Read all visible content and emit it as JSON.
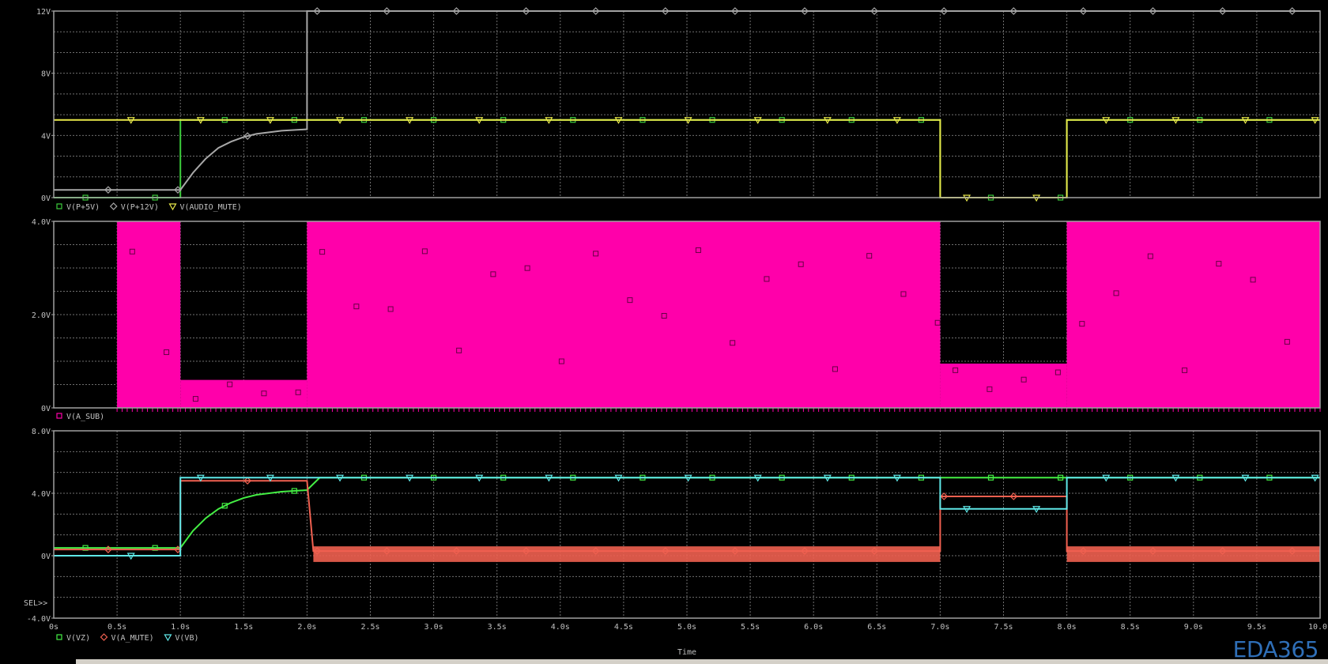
{
  "window": {
    "watermark": "EDA365",
    "sel_marker": "SEL>>"
  },
  "colors": {
    "background": "#000000",
    "grid": "#6f6f6f",
    "frame": "#a0a0a0",
    "text": "#c0c0c0",
    "green": "#3ccc3c",
    "bright_green": "#44ee44",
    "gray": "#a8a8a8",
    "yellow": "#e8e84a",
    "magenta": "#ff00aa",
    "salmon": "#f06050",
    "cyan": "#5fe8e8"
  },
  "chart_data": [
    {
      "type": "line",
      "xlim": [
        0,
        10
      ],
      "ylim": [
        0,
        12
      ],
      "yticks": [
        "0V",
        "4V",
        "8V",
        "12V"
      ],
      "grid": true,
      "legend_placement": "bottom-left",
      "series": [
        {
          "name": "V(P+5V)",
          "color": "green",
          "marker": "square",
          "points": [
            [
              0,
              0
            ],
            [
              1.0,
              0
            ],
            [
              1.0,
              5
            ],
            [
              7.0,
              5
            ],
            [
              7.0,
              0
            ],
            [
              8.0,
              0
            ],
            [
              8.0,
              5
            ],
            [
              10,
              5
            ]
          ]
        },
        {
          "name": "V(P+12V)",
          "color": "gray",
          "marker": "diamond",
          "points": [
            [
              0,
              0.5
            ],
            [
              1.0,
              0.5
            ],
            [
              1.1,
              1.6
            ],
            [
              1.2,
              2.5
            ],
            [
              1.3,
              3.2
            ],
            [
              1.4,
              3.6
            ],
            [
              1.5,
              3.9
            ],
            [
              1.6,
              4.1
            ],
            [
              1.8,
              4.3
            ],
            [
              2.0,
              4.4
            ],
            [
              2.0,
              12
            ],
            [
              10,
              12
            ]
          ]
        },
        {
          "name": "V(AUDIO_MUTE)",
          "color": "yellow",
          "marker": "triangle",
          "points": [
            [
              0,
              5
            ],
            [
              7.0,
              5
            ],
            [
              7.0,
              0
            ],
            [
              8.0,
              0
            ],
            [
              8.0,
              5
            ],
            [
              10,
              5
            ]
          ]
        }
      ]
    },
    {
      "type": "area",
      "xlim": [
        0,
        10
      ],
      "ylim": [
        0,
        4
      ],
      "yticks": [
        "0V",
        "2.0V",
        "4.0V"
      ],
      "grid": true,
      "legend_placement": "bottom-left",
      "series": [
        {
          "name": "V(A_SUB)",
          "color": "magenta",
          "marker": "square",
          "bands": [
            {
              "x": [
                0.5,
                1.0
              ],
              "low": 0,
              "high": 4.0
            },
            {
              "x": [
                1.0,
                2.0
              ],
              "low": 0,
              "high": 0.6
            },
            {
              "x": [
                2.0,
                7.0
              ],
              "low": 0,
              "high": 4.0
            },
            {
              "x": [
                7.0,
                8.0
              ],
              "low": 0,
              "high": 0.95
            },
            {
              "x": [
                8.0,
                10.0
              ],
              "low": 0,
              "high": 4.0
            }
          ]
        }
      ]
    },
    {
      "type": "line",
      "xlim": [
        0,
        10
      ],
      "ylim": [
        -4,
        8
      ],
      "yticks": [
        "-4.0V",
        "0V",
        "4.0V",
        "8.0V"
      ],
      "xticks": [
        "0s",
        "0.5s",
        "1.0s",
        "1.5s",
        "2.0s",
        "2.5s",
        "3.0s",
        "3.5s",
        "4.0s",
        "4.5s",
        "5.0s",
        "5.5s",
        "6.0s",
        "6.5s",
        "7.0s",
        "7.5s",
        "8.0s",
        "8.5s",
        "9.0s",
        "9.5s",
        "10.0s"
      ],
      "xlabel": "Time",
      "grid": true,
      "legend_placement": "bottom-left",
      "series": [
        {
          "name": "V(VZ)",
          "color": "bright_green",
          "marker": "square",
          "points": [
            [
              0,
              0.5
            ],
            [
              1.0,
              0.5
            ],
            [
              1.1,
              1.6
            ],
            [
              1.2,
              2.4
            ],
            [
              1.3,
              3.0
            ],
            [
              1.4,
              3.4
            ],
            [
              1.5,
              3.7
            ],
            [
              1.6,
              3.9
            ],
            [
              1.8,
              4.1
            ],
            [
              2.0,
              4.2
            ],
            [
              2.1,
              5.0
            ],
            [
              10,
              5.0
            ]
          ]
        },
        {
          "name": "V(A_MUTE)",
          "color": "salmon",
          "marker": "diamond",
          "points": [
            [
              0,
              0.4
            ],
            [
              1.0,
              0.4
            ],
            [
              1.0,
              4.8
            ],
            [
              2.0,
              4.8
            ],
            [
              2.05,
              0.3
            ],
            [
              7.0,
              0.3
            ],
            [
              7.0,
              3.8
            ],
            [
              8.0,
              3.8
            ],
            [
              8.0,
              0.3
            ],
            [
              10,
              0.3
            ]
          ],
          "ripple": [
            [
              2.05,
              7.0,
              -0.4,
              0.6
            ],
            [
              8.0,
              10.0,
              -0.4,
              0.6
            ]
          ]
        },
        {
          "name": "V(VB)",
          "color": "cyan",
          "marker": "triangle",
          "points": [
            [
              0,
              0
            ],
            [
              1.0,
              0
            ],
            [
              1.0,
              5.0
            ],
            [
              7.0,
              5.0
            ],
            [
              7.0,
              3.0
            ],
            [
              8.0,
              3.0
            ],
            [
              8.0,
              5.0
            ],
            [
              10,
              5.0
            ]
          ]
        }
      ]
    }
  ]
}
